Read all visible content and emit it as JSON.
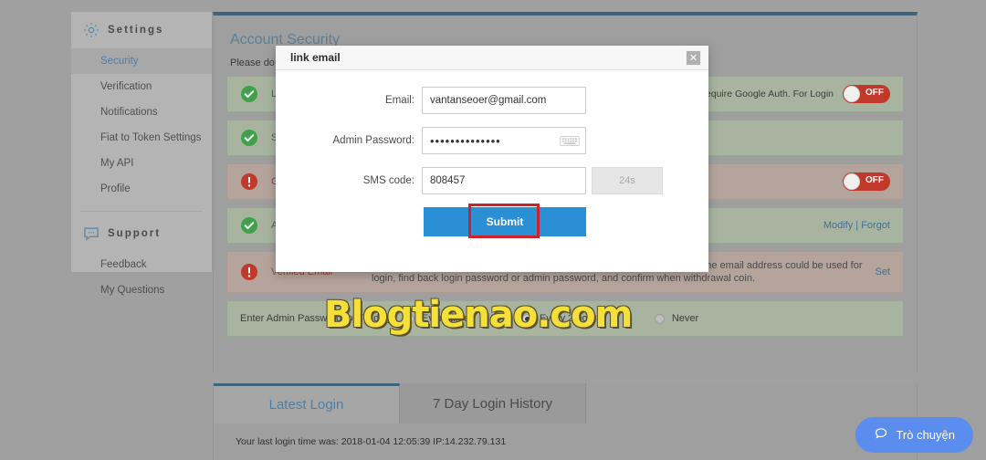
{
  "sidebar": {
    "groups": [
      {
        "icon": "gear-icon",
        "title": "Settings",
        "items": [
          {
            "label": "Security",
            "active": true
          },
          {
            "label": "Verification",
            "active": false
          },
          {
            "label": "Notifications",
            "active": false
          },
          {
            "label": "Fiat to Token Settings",
            "active": false
          },
          {
            "label": "My API",
            "active": false
          },
          {
            "label": "Profile",
            "active": false
          }
        ]
      },
      {
        "icon": "chat-bubble-icon",
        "title": "Support",
        "items": [
          {
            "label": "Feedback",
            "active": false
          },
          {
            "label": "My Questions",
            "active": false
          }
        ]
      }
    ]
  },
  "main": {
    "title": "Account Security",
    "note": "Please do no",
    "rows": [
      {
        "status": "ok",
        "label": "Lo",
        "desc": "",
        "right_text": "Require Google Auth. For Login",
        "toggle": "OFF",
        "link": ""
      },
      {
        "status": "ok",
        "label": "S",
        "desc": "",
        "right_text": "",
        "toggle": "",
        "link": ""
      },
      {
        "status": "warn",
        "label": "G",
        "desc": "",
        "right_text": "",
        "toggle": "OFF",
        "link": ""
      },
      {
        "status": "ok",
        "label": "Ad",
        "desc": "",
        "right_text": "",
        "toggle": "",
        "link": "Modify | Forgot"
      },
      {
        "status": "warn",
        "label": "Verified Email",
        "desc": "You are login user, you could link to your email address that always used. The email address could be used for login, find back login password or admin password, and confirm when withdrawal coin.",
        "right_text": "",
        "toggle": "",
        "link": "Set"
      }
    ],
    "trading_password": {
      "lead": "Enter Admin Password for Trading:",
      "options": [
        {
          "label": "Every time",
          "selected": false
        },
        {
          "label": "Every 2 hours",
          "selected": true
        },
        {
          "label": "Never",
          "selected": false
        }
      ]
    }
  },
  "bottom": {
    "tabs": [
      {
        "label": "Latest Login",
        "active": true
      },
      {
        "label": "7 Day Login History",
        "active": false
      }
    ],
    "login_info": "Your last login time was: 2018-01-04 12:05:39   IP:14.232.79.131"
  },
  "modal": {
    "title": "link email",
    "close_label": "✕",
    "fields": [
      {
        "label": "Email:",
        "value": "vantanseoer@gmail.com",
        "type": "text"
      },
      {
        "label": "Admin Password:",
        "value": "••••••••••••••",
        "type": "password"
      },
      {
        "label": "SMS code:",
        "value": "808457",
        "type": "text"
      }
    ],
    "sms_timer": "24s",
    "submit_label": "Submit"
  },
  "watermark": "Blogtienao.com",
  "chat": {
    "label": "Trò chuyện"
  },
  "colors": {
    "accent_blue": "#2a8fd4",
    "toggle_off_red": "#c0392b",
    "link_blue": "#45708e",
    "highlight_red": "#cc2229",
    "watermark_yellow": "#f5e03a",
    "chat_blue": "#5b8def",
    "panel_border_blue": "#3f6379"
  }
}
